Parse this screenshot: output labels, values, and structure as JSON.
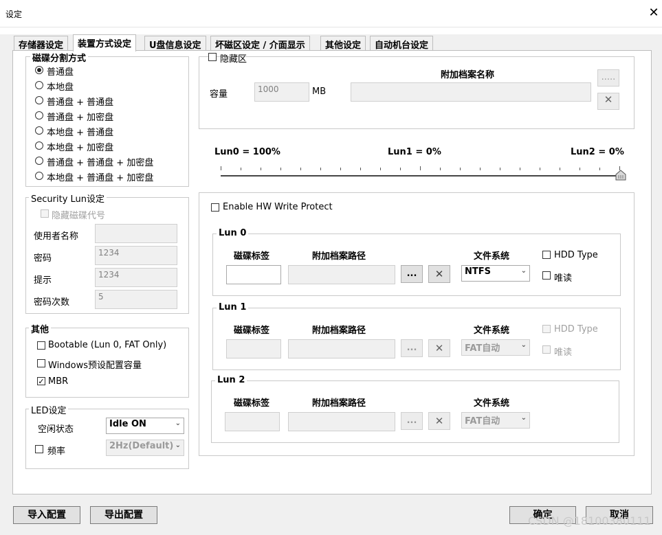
{
  "window": {
    "title": "设定",
    "close_glyph": "✕"
  },
  "tabs": [
    "存储器设定",
    "装置方式设定",
    "U盘信息设定",
    "坏磁区设定 / 介面显示",
    "其他设定",
    "自动机台设定"
  ],
  "partition": {
    "legend": "磁碟分割方式",
    "options": [
      "普通盘",
      "本地盘",
      "普通盘 + 普通盘",
      "普通盘 + 加密盘",
      "本地盘 + 普通盘",
      "本地盘 + 加密盘",
      "普通盘 + 普通盘 + 加密盘",
      "本地盘 + 普通盘 + 加密盘"
    ],
    "selected_index": 0
  },
  "security": {
    "legend": "Security Lun设定",
    "hide_label": "隐藏磁碟代号",
    "username_label": "使用者名称",
    "username_value": "",
    "password_label": "密码",
    "password_value": "1234",
    "hint_label": "提示",
    "hint_value": "1234",
    "retries_label": "密码次数",
    "retries_value": "5"
  },
  "other": {
    "legend": "其他",
    "bootable_label": "Bootable (Lun 0, FAT Only)",
    "windows_label": "Windows预设配置容量",
    "mbr_label": "MBR",
    "mbr_checked": true
  },
  "led": {
    "legend": "LED设定",
    "idle_label": "空闲状态",
    "idle_value": "Idle ON",
    "freq_label": "频率",
    "freq_value": "2Hz(Default)"
  },
  "hidden": {
    "label": "隐藏区",
    "capacity_label": "容量",
    "capacity_value": "1000",
    "unit": "MB",
    "attach_label": "附加档案名称",
    "browse_label": "....."
  },
  "slider": {
    "lun0": "Lun0 = 100%",
    "lun1": "Lun1 = 0%",
    "lun2": "Lun2 = 0%",
    "position_percent": 100
  },
  "luns": {
    "hw_protect_label": "Enable HW Write Protect",
    "col_label": "磁碟标签",
    "col_path": "附加档案路径",
    "col_fs": "文件系统",
    "browse": "...",
    "hdd_type": "HDD Type",
    "readonly": "唯读",
    "lun0": {
      "name": "Lun 0",
      "fs": "NTFS"
    },
    "lun1": {
      "name": "Lun 1",
      "fs": "FAT自动"
    },
    "lun2": {
      "name": "Lun 2",
      "fs": "FAT自动"
    }
  },
  "footer": {
    "import": "导入配置",
    "export": "导出配置",
    "ok": "确定",
    "cancel": "取消",
    "watermark": "CSDN @18100380111"
  },
  "colors": {
    "panel": "#ffffff",
    "dialog": "#f0f0f0",
    "border": "#bdbdbd"
  }
}
